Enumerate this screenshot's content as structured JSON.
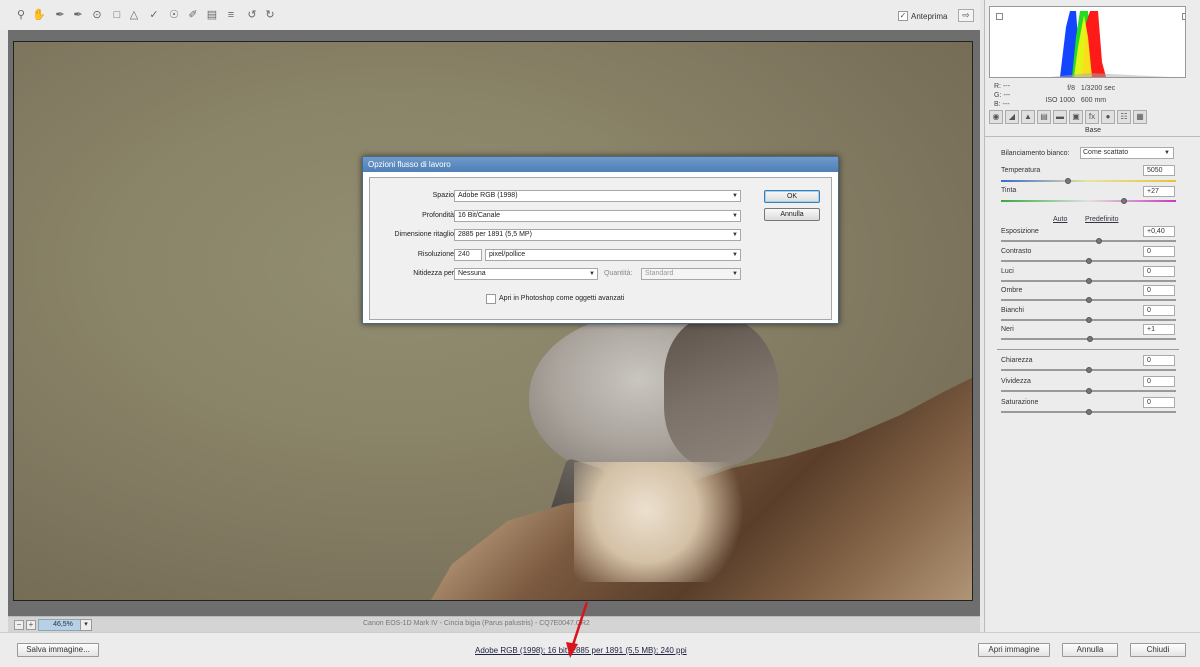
{
  "toolbar": {
    "tools": [
      "zoom-icon",
      "hand-icon",
      "white-balance-icon",
      "color-sampler-icon",
      "target-adjust-icon",
      "crop-icon",
      "straighten-icon",
      "spot-removal-icon",
      "red-eye-icon",
      "adjustment-brush-icon",
      "graduated-filter-icon",
      "list-icon",
      "rotate-left-icon",
      "rotate-right-icon"
    ],
    "preview_label": "Anteprima"
  },
  "canvas": {
    "zoom": "46,5%",
    "file_info": "Canon EOS-1D Mark IV  -  Cincia bigia (Parus palustris)  -  CQ7E0047.CR2"
  },
  "bottom": {
    "save_label": "Salva immagine...",
    "workflow_link": "Adobe RGB (1998); 16 bit; 2885 per 1891 (5,5 MB); 240 ppi",
    "open_label": "Apri immagine",
    "cancel_label": "Annulla",
    "close_label": "Chiudi"
  },
  "panel": {
    "rgb": {
      "r": "R:  ---",
      "g": "G:  ---",
      "b": "B:  ---"
    },
    "exif": {
      "aperture": "f/8",
      "shutter": "1/3200 sec",
      "iso": "ISO 1000",
      "focal": "600 mm"
    },
    "section_title": "Base",
    "wb_label": "Bilanciamento bianco:",
    "wb_value": "Come scattato",
    "temperature_label": "Temperatura",
    "temperature_value": "5050",
    "tint_label": "Tinta",
    "tint_value": "+27",
    "auto_link": "Auto",
    "default_link": "Predefinito",
    "sliders": [
      {
        "label": "Esposizione",
        "value": "+0,40"
      },
      {
        "label": "Contrasto",
        "value": "0"
      },
      {
        "label": "Luci",
        "value": "0"
      },
      {
        "label": "Ombre",
        "value": "0"
      },
      {
        "label": "Bianchi",
        "value": "0"
      },
      {
        "label": "Neri",
        "value": "+1"
      }
    ],
    "sliders2": [
      {
        "label": "Chiarezza",
        "value": "0"
      },
      {
        "label": "Vividezza",
        "value": "0"
      },
      {
        "label": "Saturazione",
        "value": "0"
      }
    ]
  },
  "dialog": {
    "title": "Opzioni flusso di lavoro",
    "space_label": "Spazio:",
    "space_value": "Adobe RGB (1998)",
    "depth_label": "Profondità:",
    "depth_value": "16 Bit/Canale",
    "crop_label": "Dimensione ritaglio:",
    "crop_value": "2885 per 1891 (5,5 MP)",
    "resolution_label": "Risoluzione:",
    "resolution_value": "240",
    "resolution_unit": "pixel/pollice",
    "sharpen_label": "Nitidezza per:",
    "sharpen_value": "Nessuna",
    "amount_label": "Quantità:",
    "amount_value": "Standard",
    "smart_objects_label": "Apri in Photoshop come oggetti avanzati",
    "ok_label": "OK",
    "cancel_label": "Annulla"
  }
}
